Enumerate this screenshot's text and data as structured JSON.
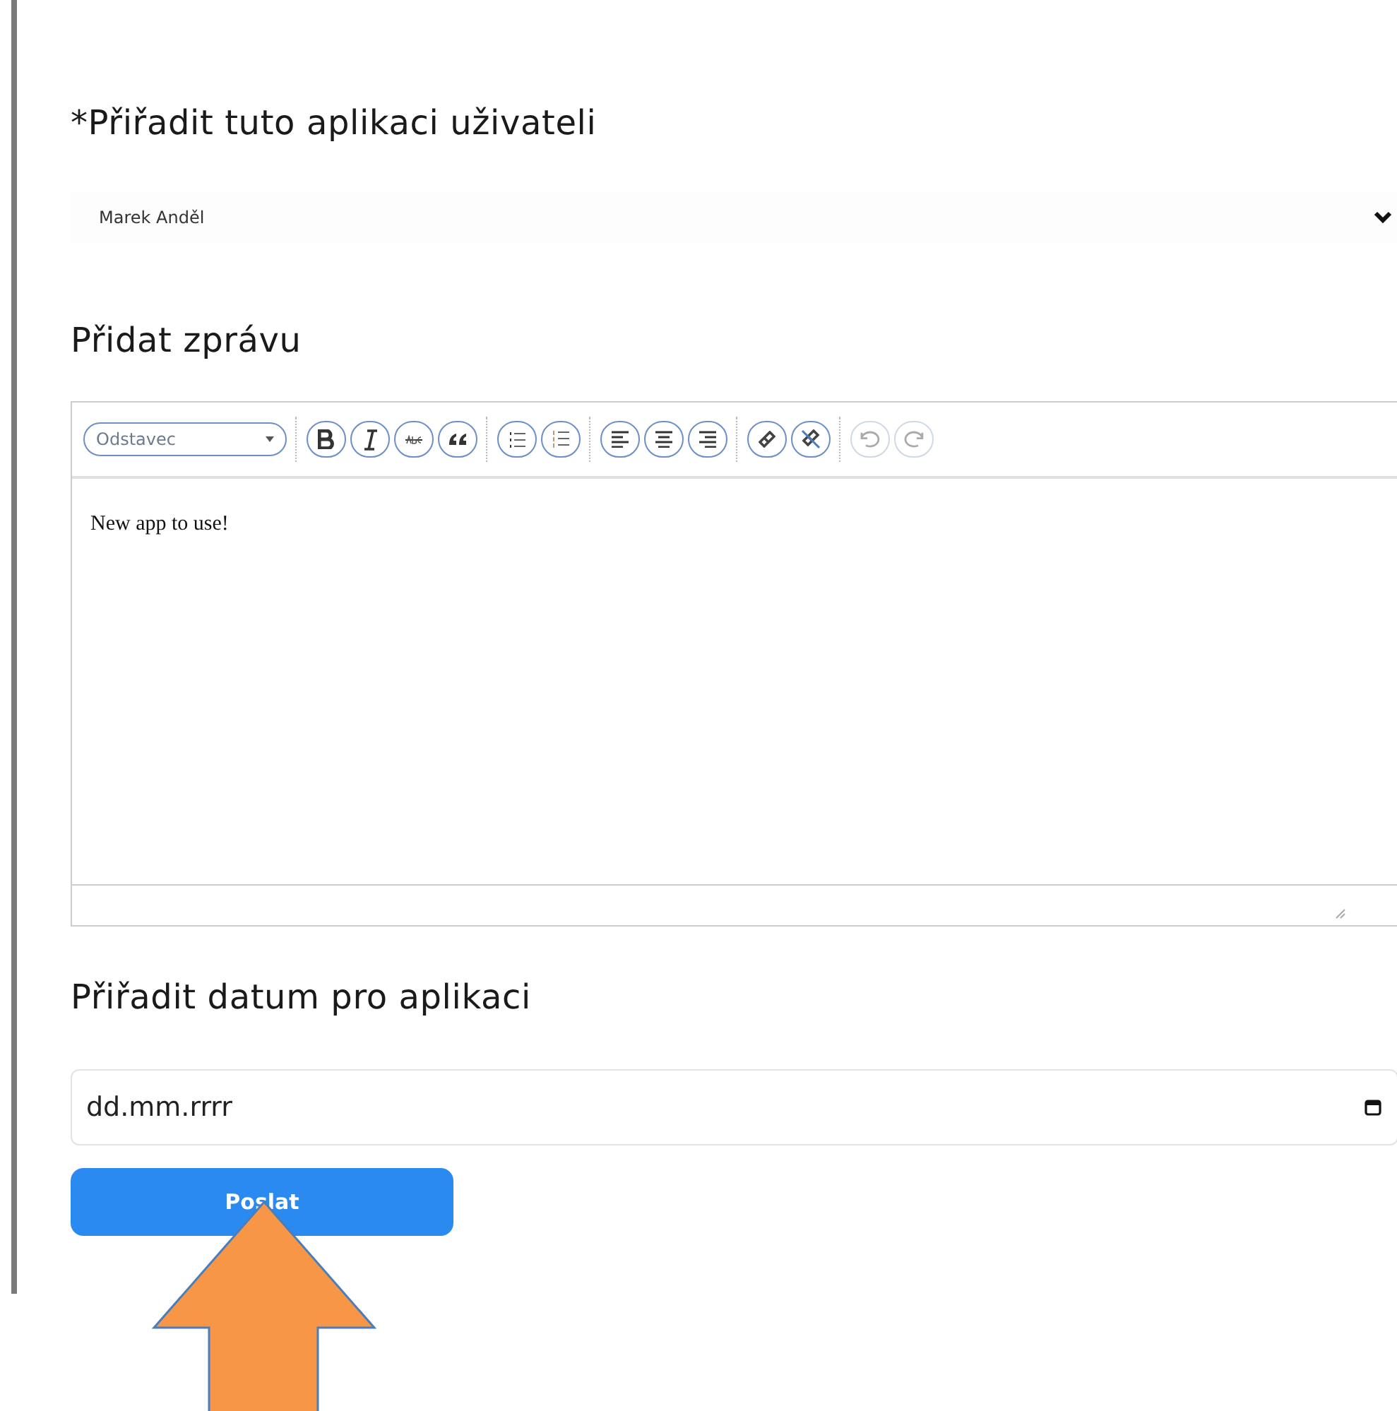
{
  "assign_user": {
    "label": "*Přiřadit tuto aplikaci uživateli",
    "value": "Marek Anděl"
  },
  "message": {
    "label": "Přidat zprávu",
    "format_select": {
      "value": "Odstavec"
    },
    "toolbar_groups": [
      [
        {
          "kind": "bold",
          "disabled": false
        },
        {
          "kind": "italic",
          "disabled": false
        },
        {
          "kind": "strike",
          "disabled": false
        },
        {
          "kind": "quote",
          "disabled": false
        }
      ],
      [
        {
          "kind": "bullets",
          "disabled": false
        },
        {
          "kind": "numbers",
          "disabled": false
        }
      ],
      [
        {
          "kind": "align-left",
          "disabled": false
        },
        {
          "kind": "align-center",
          "disabled": false
        },
        {
          "kind": "align-right",
          "disabled": false
        }
      ],
      [
        {
          "kind": "link",
          "disabled": false
        },
        {
          "kind": "unlink",
          "disabled": false
        }
      ],
      [
        {
          "kind": "undo",
          "disabled": true
        },
        {
          "kind": "redo",
          "disabled": true
        }
      ]
    ],
    "text": "New app to use!"
  },
  "date": {
    "label": "Přiřadit datum pro aplikaci",
    "placeholder": "dd.mm.rrrr"
  },
  "submit": {
    "label": "Poslat"
  }
}
